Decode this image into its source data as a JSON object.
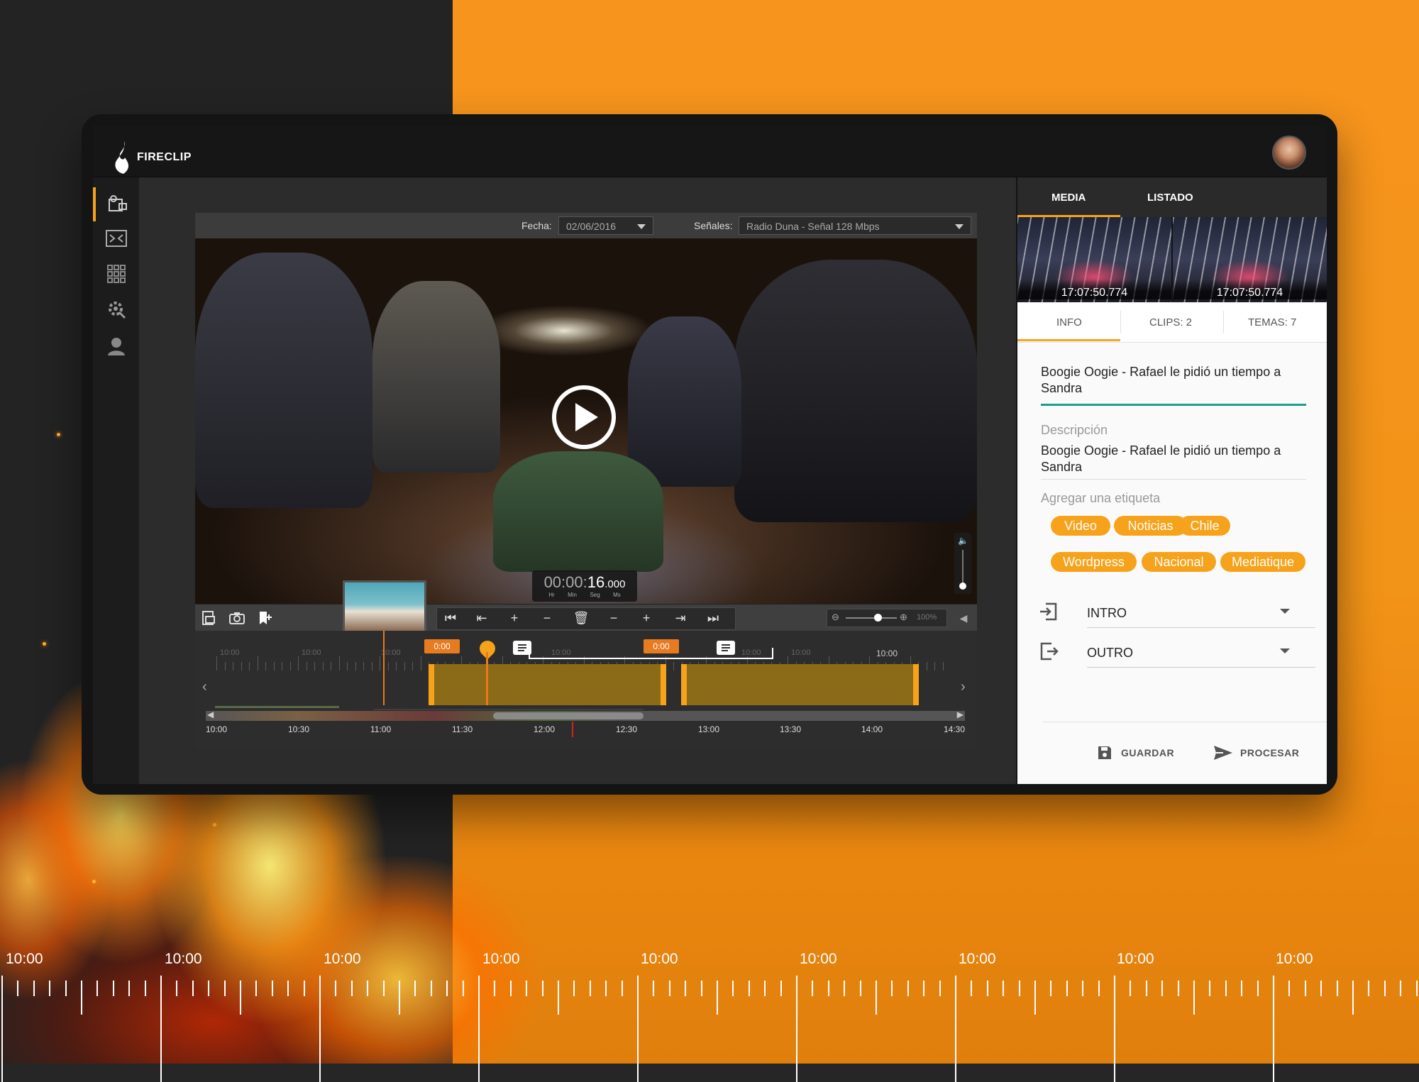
{
  "app": {
    "name": "FIRECLIP"
  },
  "ruler": {
    "labels": [
      "10:00",
      "10:00",
      "10:00",
      "10:00",
      "10:00",
      "10:00",
      "10:00",
      "10:00",
      "10:00"
    ]
  },
  "sidebar": {
    "items": [
      {
        "name": "media-editor",
        "icon": "film-editor-icon",
        "active": true
      },
      {
        "name": "clip-compare",
        "icon": "split-frame-icon"
      },
      {
        "name": "grid",
        "icon": "grid-icon"
      },
      {
        "name": "settings",
        "icon": "gear-icon"
      },
      {
        "name": "user",
        "icon": "user-icon"
      }
    ]
  },
  "editor": {
    "fecha_label": "Fecha:",
    "fecha_value": "02/06/2016",
    "senales_label": "Señales:",
    "senales_value": "Radio Duna - Señal 128 Mbps",
    "timecode": {
      "dim": "00:00:",
      "sec": "16",
      "ms": ".000",
      "units": [
        "Hr",
        "Min",
        "Seg",
        "Ms"
      ]
    },
    "zoom_percent": "100%",
    "timeline": {
      "faded_labels": [
        "10:00",
        "10:00",
        "10:00",
        "10:00",
        "10:00",
        "10:00"
      ],
      "bright_label": "10:00",
      "badge_1": "0:00",
      "badge_2": "0:00",
      "hours": [
        "10:00",
        "10:30",
        "11:00",
        "11:30",
        "12:00",
        "12:30",
        "13:00",
        "13:30",
        "14:00",
        "14:30"
      ]
    }
  },
  "panel": {
    "tabs": [
      "MEDIA",
      "LISTADO"
    ],
    "thumb_times": [
      "17:07:50.774",
      "17:07:50.774"
    ],
    "subtabs": [
      "INFO",
      "CLIPS: 2",
      "TEMAS: 7"
    ],
    "title": "Boogie Oogie - Rafael le pidió un tiempo a Sandra",
    "description_label": "Descripción",
    "description": "Boogie Oogie - Rafael le pidió un tiempo a Sandra",
    "tag_placeholder": "Agregar una etiqueta",
    "tags": [
      "Video",
      "Noticias",
      "Chile",
      "Wordpress",
      "Nacional",
      "Mediatique"
    ],
    "intro": "INTRO",
    "outro": "OUTRO",
    "save": "GUARDAR",
    "process": "PROCESAR"
  },
  "colors": {
    "accent": "#f7a21b",
    "teal": "#1a9e8c",
    "orange_bg": "#f7941d",
    "dark_bg": "#232323"
  }
}
